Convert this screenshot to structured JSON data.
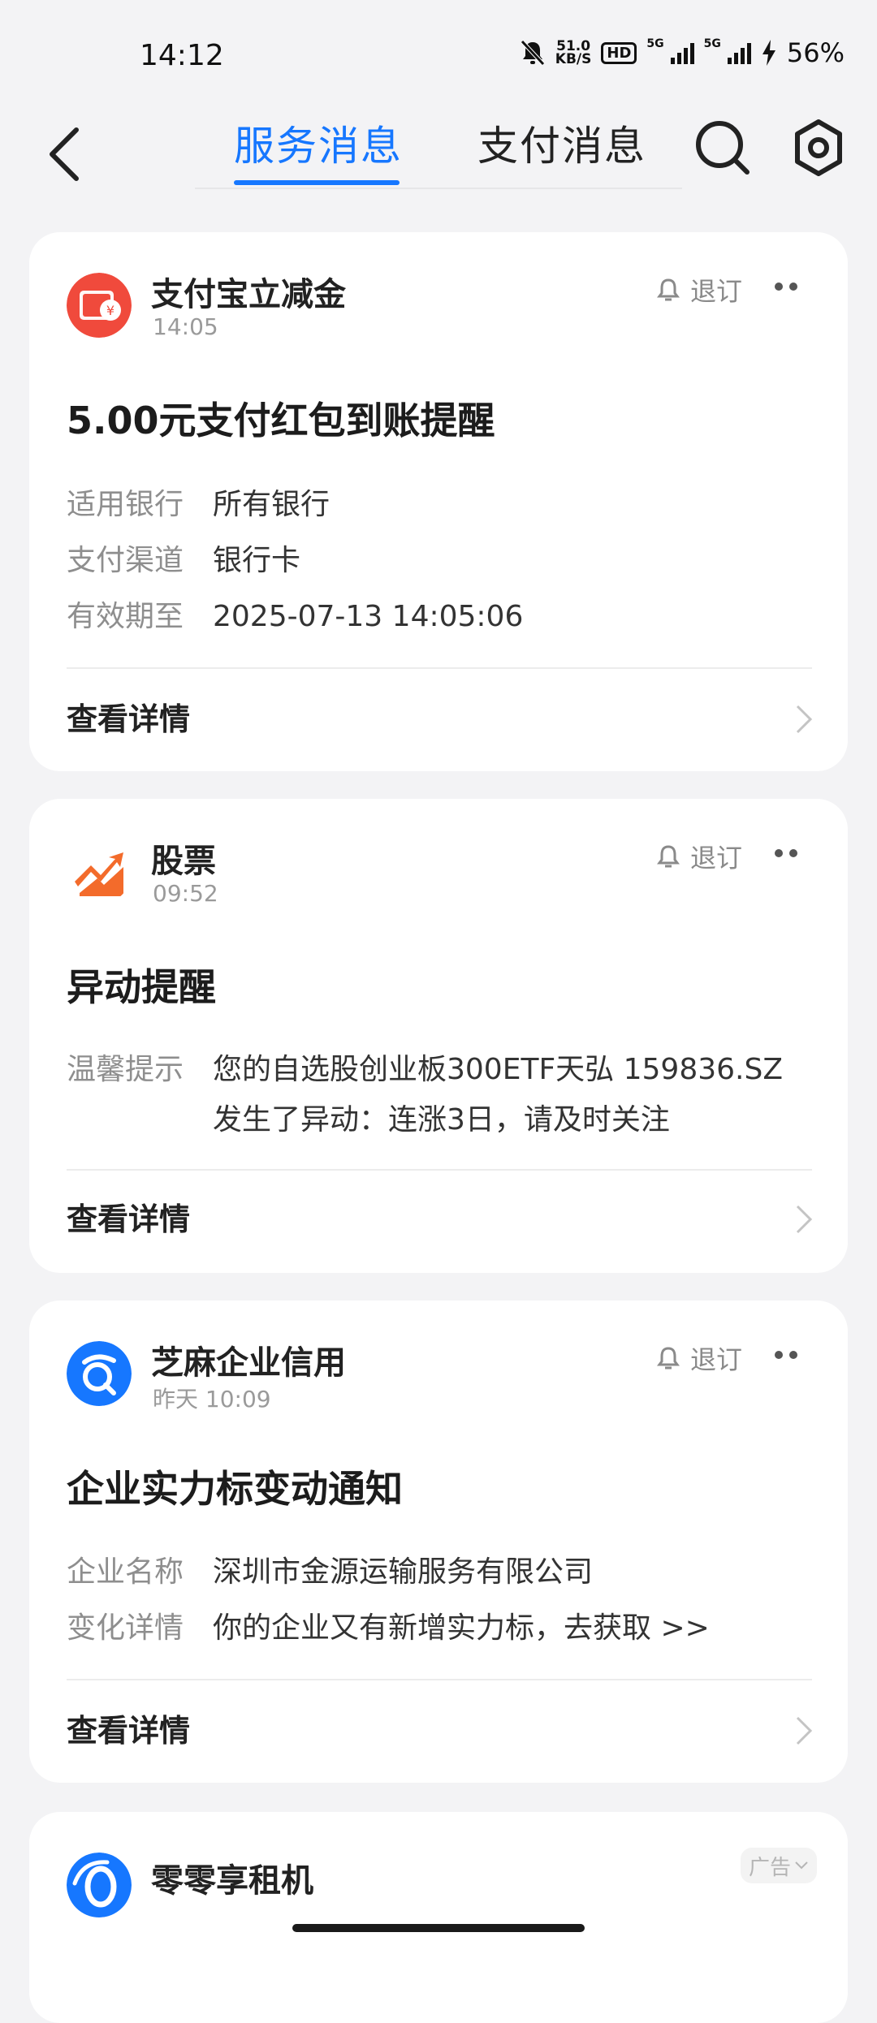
{
  "status_bar": {
    "time": "14:12",
    "net_speed_value": "51.0",
    "net_speed_unit": "KB/S",
    "hd_badge": "HD",
    "signal1_label": "5G",
    "signal2_label": "5G",
    "battery": "56%"
  },
  "header": {
    "tabs": [
      {
        "label": "服务消息",
        "active": true
      },
      {
        "label": "支付消息",
        "active": false
      }
    ],
    "accent_color": "#1677ff"
  },
  "cards": [
    {
      "sender": "支付宝立减金",
      "time": "14:05",
      "unsubscribe": "退订",
      "headline": "5.00元支付红包到账提醒",
      "rows": [
        {
          "key": "适用银行",
          "value": "所有银行"
        },
        {
          "key": "支付渠道",
          "value": "银行卡"
        },
        {
          "key": "有效期至",
          "value": "2025-07-13 14:05:06"
        }
      ],
      "detail": "查看详情",
      "icon": "red-envelope-icon"
    },
    {
      "sender": "股票",
      "time": "09:52",
      "unsubscribe": "退订",
      "headline": "异动提醒",
      "rows": [
        {
          "key": "温馨提示",
          "value_line1": "您的自选股创业板300ETF天弘 159836.SZ",
          "value_line2": "发生了异动：连涨3日，请及时关注"
        }
      ],
      "detail": "查看详情",
      "icon": "stock-trend-icon"
    },
    {
      "sender": "芝麻企业信用",
      "time": "昨天 10:09",
      "unsubscribe": "退订",
      "headline": "企业实力标变动通知",
      "rows": [
        {
          "key": "企业名称",
          "value": "深圳市金源运输服务有限公司"
        },
        {
          "key": "变化详情",
          "value": "你的企业又有新增实力标，去获取 >>"
        }
      ],
      "detail": "查看详情",
      "icon": "zhima-credit-icon"
    },
    {
      "sender": "零零享租机",
      "ad_label": "广告",
      "icon": "lingling-logo-icon"
    }
  ]
}
